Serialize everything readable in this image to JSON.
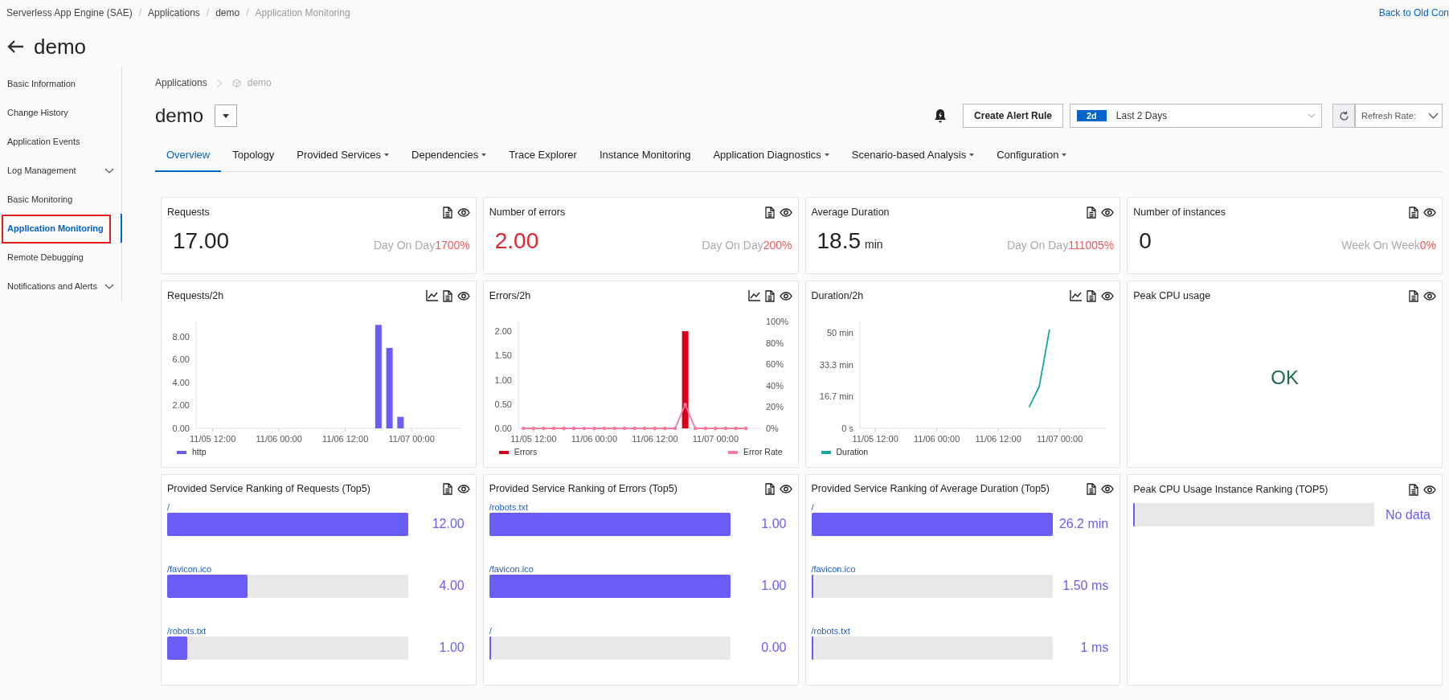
{
  "breadcrumb": [
    {
      "label": "Serverless App Engine (SAE)",
      "current": false
    },
    {
      "separator": "/",
      "label": "Applications",
      "current": false
    },
    {
      "separator": "/",
      "label": "demo",
      "current": false
    },
    {
      "separator": "/",
      "label": "Application Monitoring",
      "current": true
    }
  ],
  "back_link": "Back to Old Con",
  "page_title": "demo",
  "sidebar": {
    "items": [
      {
        "label": "Basic Information",
        "selected": false,
        "expandable": false,
        "annotated": false
      },
      {
        "label": "Change History",
        "selected": false,
        "expandable": false,
        "annotated": false
      },
      {
        "label": "Application Events",
        "selected": false,
        "expandable": false,
        "annotated": false
      },
      {
        "label": "Log Management",
        "selected": false,
        "expandable": true,
        "annotated": false
      },
      {
        "label": "Basic Monitoring",
        "selected": false,
        "expandable": false,
        "annotated": false
      },
      {
        "label": "Application Monitoring",
        "selected": true,
        "expandable": false,
        "annotated": true
      },
      {
        "label": "Remote Debugging",
        "selected": false,
        "expandable": false,
        "annotated": false
      },
      {
        "label": "Notifications and Alerts",
        "selected": false,
        "expandable": true,
        "annotated": false
      }
    ]
  },
  "content": {
    "breadcrumb": [
      {
        "label": "Applications",
        "current": false
      },
      {
        "label": "demo",
        "current": true
      }
    ],
    "title": "demo",
    "create_alert_button": "Create Alert Rule",
    "time_range": {
      "badge": "2d",
      "label": "Last 2 Days"
    },
    "refresh_rate": {
      "label": "Refresh Rate:"
    },
    "tabs": [
      {
        "label": "Overview",
        "selected": true,
        "has_menu": false
      },
      {
        "label": "Topology",
        "selected": false,
        "has_menu": false
      },
      {
        "label": "Provided Services",
        "selected": false,
        "has_menu": true
      },
      {
        "label": "Dependencies",
        "selected": false,
        "has_menu": true
      },
      {
        "label": "Trace Explorer",
        "selected": false,
        "has_menu": false
      },
      {
        "label": "Instance Monitoring",
        "selected": false,
        "has_menu": false
      },
      {
        "label": "Application Diagnostics",
        "selected": false,
        "has_menu": true
      },
      {
        "label": "Scenario-based Analysis",
        "selected": false,
        "has_menu": true
      },
      {
        "label": "Configuration",
        "selected": false,
        "has_menu": true
      }
    ],
    "cards": [
      {
        "kind": "stat",
        "title": "Requests",
        "value": "17.00",
        "color": "#222222",
        "compare_label": "Day On Day",
        "compare_value": "1700%"
      },
      {
        "kind": "stat",
        "title": "Number of errors",
        "value": "2.00",
        "color": "#e0242e",
        "compare_label": "Day On Day",
        "compare_value": "200%"
      },
      {
        "kind": "stat",
        "title": "Average Duration",
        "value": "18.5",
        "unit": "min",
        "color": "#222222",
        "compare_label": "Day On Day",
        "compare_value": "111005%"
      },
      {
        "kind": "stat",
        "title": "Number of instances",
        "value": "0",
        "color": "#222222",
        "compare_label": "Week On Week",
        "compare_value": "0%"
      },
      {
        "kind": "chart",
        "title": "Requests/2h",
        "chart_data": {
          "type": "bar",
          "categories": [
            null,
            "11/05 12:00",
            null,
            null,
            null,
            null,
            null,
            "11/06 00:00",
            null,
            null,
            null,
            null,
            null,
            "11/06 12:00",
            null,
            null,
            null,
            null,
            null,
            "11/07 00:00",
            null,
            null,
            null,
            null
          ],
          "ylim": [
            0,
            9.3
          ],
          "yticks": [
            {
              "value": 0,
              "label": "0.00"
            },
            {
              "value": 2,
              "label": "2.00"
            },
            {
              "value": 4,
              "label": "4.00"
            },
            {
              "value": 6,
              "label": "6.00"
            },
            {
              "value": 8,
              "label": "8.00"
            }
          ],
          "series": [
            {
              "name": "http",
              "color": "#6b5cf6",
              "values": [
                null,
                null,
                null,
                null,
                null,
                null,
                null,
                null,
                null,
                null,
                null,
                null,
                null,
                null,
                null,
                null,
                9,
                7,
                1,
                null,
                null,
                null,
                null,
                null
              ]
            }
          ]
        }
      },
      {
        "kind": "chart",
        "title": "Errors/2h",
        "chart_data": {
          "type": "bar",
          "categories": [
            null,
            "11/05 12:00",
            null,
            null,
            null,
            null,
            null,
            "11/06 00:00",
            null,
            null,
            null,
            null,
            null,
            "11/06 12:00",
            null,
            null,
            null,
            null,
            null,
            "11/07 00:00",
            null,
            null,
            null,
            null
          ],
          "ylim": [
            0,
            2.2
          ],
          "y2lim": [
            0,
            100
          ],
          "yticks": [
            {
              "value": 0,
              "label": "0.00"
            },
            {
              "value": 0.5,
              "label": "0.50"
            },
            {
              "value": 1,
              "label": "1.00"
            },
            {
              "value": 1.5,
              "label": "1.50"
            },
            {
              "value": 2,
              "label": "2.00"
            }
          ],
          "y2ticks": [
            {
              "value": 0,
              "label": "0%"
            },
            {
              "value": 20,
              "label": "20%"
            },
            {
              "value": 40,
              "label": "40%"
            },
            {
              "value": 60,
              "label": "60%"
            },
            {
              "value": 80,
              "label": "80%"
            },
            {
              "value": 100,
              "label": "100%"
            }
          ],
          "series": [
            {
              "name": "Errors",
              "color": "#d9001b",
              "values": [
                null,
                null,
                null,
                null,
                null,
                null,
                null,
                null,
                null,
                null,
                null,
                null,
                null,
                null,
                null,
                null,
                2,
                null,
                null,
                null,
                null,
                null,
                null,
                null
              ]
            },
            {
              "name": "Error Rate",
              "color": "#f5799a",
              "axis": "y2",
              "type": "line",
              "values": [
                0,
                0,
                0,
                0,
                0,
                0,
                0,
                0,
                0,
                0,
                0,
                0,
                0,
                0,
                0,
                0,
                22.2,
                0,
                0,
                0,
                0,
                0,
                0,
                null
              ]
            }
          ]
        }
      },
      {
        "kind": "chart",
        "title": "Duration/2h",
        "chart_data": {
          "type": "line",
          "categories": [
            null,
            "11/05 12:00",
            null,
            null,
            null,
            null,
            null,
            "11/06 00:00",
            null,
            null,
            null,
            null,
            null,
            "11/06 12:00",
            null,
            null,
            null,
            null,
            null,
            "11/07 00:00",
            null,
            null,
            null,
            null
          ],
          "ylim": [
            0,
            56
          ],
          "yticks": [
            {
              "value": 0,
              "label": "0 s"
            },
            {
              "value": 16.7,
              "label": "16.7 min"
            },
            {
              "value": 33.3,
              "label": "33.3 min"
            },
            {
              "value": 50,
              "label": "50 min"
            }
          ],
          "series": [
            {
              "name": "Duration",
              "color": "#13a89e",
              "values": [
                null,
                null,
                null,
                null,
                null,
                null,
                null,
                null,
                null,
                null,
                null,
                null,
                null,
                null,
                null,
                null,
                11.1,
                21.8,
                51.8,
                null,
                null,
                null,
                null,
                null
              ]
            }
          ]
        }
      },
      {
        "kind": "status",
        "title": "Peak CPU usage",
        "value": "OK"
      },
      {
        "kind": "ranking",
        "title": "Provided Service Ranking of Requests (Top5)",
        "items": [
          {
            "label": "/",
            "level": 1,
            "value": "12.00"
          },
          {
            "label": "/favicon.ico",
            "level": 0.333,
            "value": "4.00"
          },
          {
            "label": "/robots.txt",
            "level": 0.083,
            "value": "1.00"
          }
        ]
      },
      {
        "kind": "ranking",
        "title": "Provided Service Ranking of Errors (Top5)",
        "items": [
          {
            "label": "/robots.txt",
            "level": 1,
            "value": "1.00"
          },
          {
            "label": "/favicon.ico",
            "level": 1,
            "value": "1.00"
          },
          {
            "label": "/",
            "level": 0,
            "value": "0.00"
          }
        ]
      },
      {
        "kind": "ranking",
        "title": "Provided Service Ranking of Average Duration (Top5)",
        "items": [
          {
            "label": "/",
            "level": 1,
            "value": "26.2 min"
          },
          {
            "label": "/favicon.ico",
            "level": 0,
            "value": "1.50 ms"
          },
          {
            "label": "/robots.txt",
            "level": 0,
            "value": "1 ms"
          }
        ]
      },
      {
        "kind": "ranking",
        "title": "Peak CPU Usage Instance Ranking (TOP5)",
        "items": [
          {
            "level": 0,
            "value": "No data"
          }
        ]
      }
    ]
  }
}
